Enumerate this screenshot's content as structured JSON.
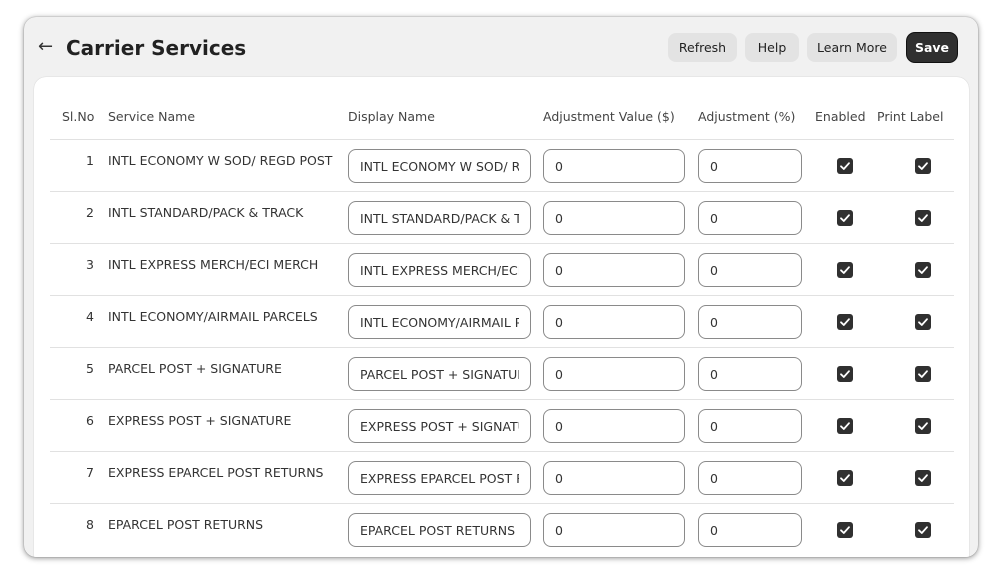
{
  "header": {
    "title": "Carrier Services",
    "buttons": {
      "refresh": "Refresh",
      "help": "Help",
      "learn_more": "Learn More",
      "save": "Save"
    }
  },
  "table": {
    "columns": {
      "sl_no": "Sl.No",
      "service_name": "Service Name",
      "display_name": "Display Name",
      "adjustment_value": "Adjustment Value ($)",
      "adjustment_pct": "Adjustment (%)",
      "enabled": "Enabled",
      "print_label": "Print Label"
    },
    "rows": [
      {
        "sl": "1",
        "service": "INTL ECONOMY W SOD/ REGD POST",
        "display": "INTL ECONOMY W SOD/ REGD POST",
        "adj_value": "0",
        "adj_pct": "0",
        "enabled": true,
        "print_label": true
      },
      {
        "sl": "2",
        "service": "INTL STANDARD/PACK & TRACK",
        "display": "INTL STANDARD/PACK & TRACK",
        "adj_value": "0",
        "adj_pct": "0",
        "enabled": true,
        "print_label": true
      },
      {
        "sl": "3",
        "service": "INTL EXPRESS MERCH/ECI MERCH",
        "display": "INTL EXPRESS MERCH/ECI MERCH",
        "adj_value": "0",
        "adj_pct": "0",
        "enabled": true,
        "print_label": true
      },
      {
        "sl": "4",
        "service": "INTL ECONOMY/AIRMAIL PARCELS",
        "display": "INTL ECONOMY/AIRMAIL PARCELS",
        "adj_value": "0",
        "adj_pct": "0",
        "enabled": true,
        "print_label": true
      },
      {
        "sl": "5",
        "service": "PARCEL POST + SIGNATURE",
        "display": "PARCEL POST + SIGNATURE",
        "adj_value": "0",
        "adj_pct": "0",
        "enabled": true,
        "print_label": true
      },
      {
        "sl": "6",
        "service": "EXPRESS POST + SIGNATURE",
        "display": "EXPRESS POST + SIGNATURE",
        "adj_value": "0",
        "adj_pct": "0",
        "enabled": true,
        "print_label": true
      },
      {
        "sl": "7",
        "service": "EXPRESS EPARCEL POST RETURNS",
        "display": "EXPRESS EPARCEL POST RETURNS",
        "adj_value": "0",
        "adj_pct": "0",
        "enabled": true,
        "print_label": true
      },
      {
        "sl": "8",
        "service": "EPARCEL POST RETURNS",
        "display": "EPARCEL POST RETURNS",
        "adj_value": "0",
        "adj_pct": "0",
        "enabled": true,
        "print_label": true
      }
    ]
  },
  "icons": {
    "back": "arrow-left-icon",
    "checkbox": "checkmark-icon"
  }
}
